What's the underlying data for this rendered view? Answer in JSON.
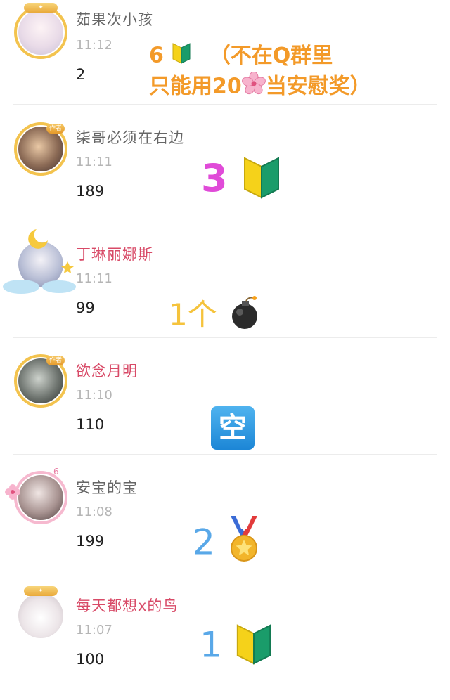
{
  "entries": [
    {
      "name": "茹果次小孩",
      "time": "11:12",
      "score": "2",
      "name_color": "gray",
      "avatar_badge": "",
      "annotation": "6🔰（不在Q群里 只能用20🌸当安慰奖）"
    },
    {
      "name": "柒哥必须在右边",
      "time": "11:11",
      "score": "189",
      "name_color": "gray",
      "avatar_badge": "作者",
      "annotation": "3🔰"
    },
    {
      "name": "丁琳丽娜斯",
      "time": "11:11",
      "score": "99",
      "name_color": "red",
      "avatar_badge": "",
      "annotation": "1个💣"
    },
    {
      "name": "欲念月明",
      "time": "11:10",
      "score": "110",
      "name_color": "red",
      "avatar_badge": "作者",
      "annotation": "🈳"
    },
    {
      "name": "安宝的宝",
      "time": "11:08",
      "score": "199",
      "name_color": "gray",
      "avatar_badge": "6",
      "annotation": "2🏅"
    },
    {
      "name": "每天都想x的鸟",
      "time": "11:07",
      "score": "100",
      "name_color": "red",
      "avatar_badge": "",
      "annotation": "1🔰"
    }
  ],
  "annotations": {
    "a1_line1_num": "6",
    "a1_line1_text": "（不在Q群里",
    "a1_line2_prefix": "只能用20",
    "a1_line2_suffix": "当安慰奖）",
    "a2_num": "3",
    "a3_text": "1个",
    "a4_text": "空",
    "a5_num": "2",
    "a6_num": "1"
  },
  "colors": {
    "name_red": "#d84a67",
    "name_gray": "#666666",
    "time_gray": "#b5b5b5",
    "note_orange": "#f39a29",
    "note_magenta": "#e04bd8",
    "note_yellow": "#f5c33c",
    "note_blue": "#59a8e8"
  },
  "icons": [
    "beginner-mark-icon",
    "cherry-blossom-icon",
    "bomb-icon",
    "empty-square-icon",
    "medal-icon"
  ]
}
